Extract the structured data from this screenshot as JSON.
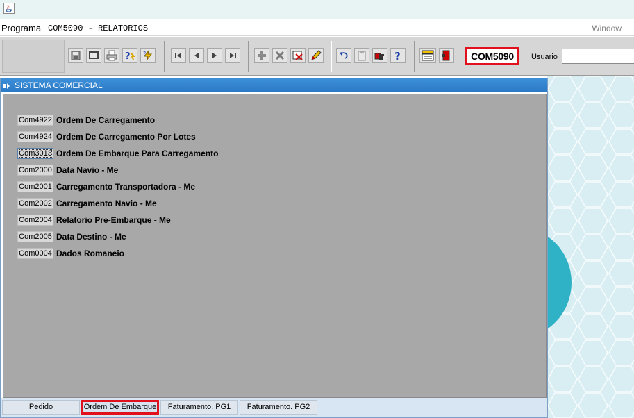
{
  "menubar": {
    "programa": "Programa",
    "window_title": "COM5090 - RELATORIOS",
    "window_menu": "Window"
  },
  "toolbar": {
    "program_code": "COM5090",
    "usuario_label": "Usuario",
    "usuario_value": ""
  },
  "panel": {
    "title": "SISTEMA COMERCIAL",
    "rows": [
      {
        "code": "Com4922",
        "label": "Ordem De Carregamento"
      },
      {
        "code": "Com4924",
        "label": "Ordem De Carregamento Por Lotes"
      },
      {
        "code": "Com3013",
        "label": "Ordem De Embarque Para Carregamento"
      },
      {
        "code": "Com2000",
        "label": "Data Navio - Me"
      },
      {
        "code": "Com2001",
        "label": "Carregamento Transportadora - Me"
      },
      {
        "code": "Com2002",
        "label": "Carregamento Navio - Me"
      },
      {
        "code": "Com2004",
        "label": "Relatorio Pre-Embarque - Me"
      },
      {
        "code": "Com2005",
        "label": "Data Destino - Me"
      },
      {
        "code": "Com0004",
        "label": "Dados Romaneio"
      }
    ]
  },
  "tabs": [
    {
      "label": "Pedido"
    },
    {
      "label": "Ordem De Embarque"
    },
    {
      "label": "Faturamento. PG1"
    },
    {
      "label": "Faturamento. PG2"
    }
  ],
  "colors": {
    "highlight": "#e0101c",
    "panel_title": "#2a79c6",
    "panel_body": "#a8a8a8"
  }
}
